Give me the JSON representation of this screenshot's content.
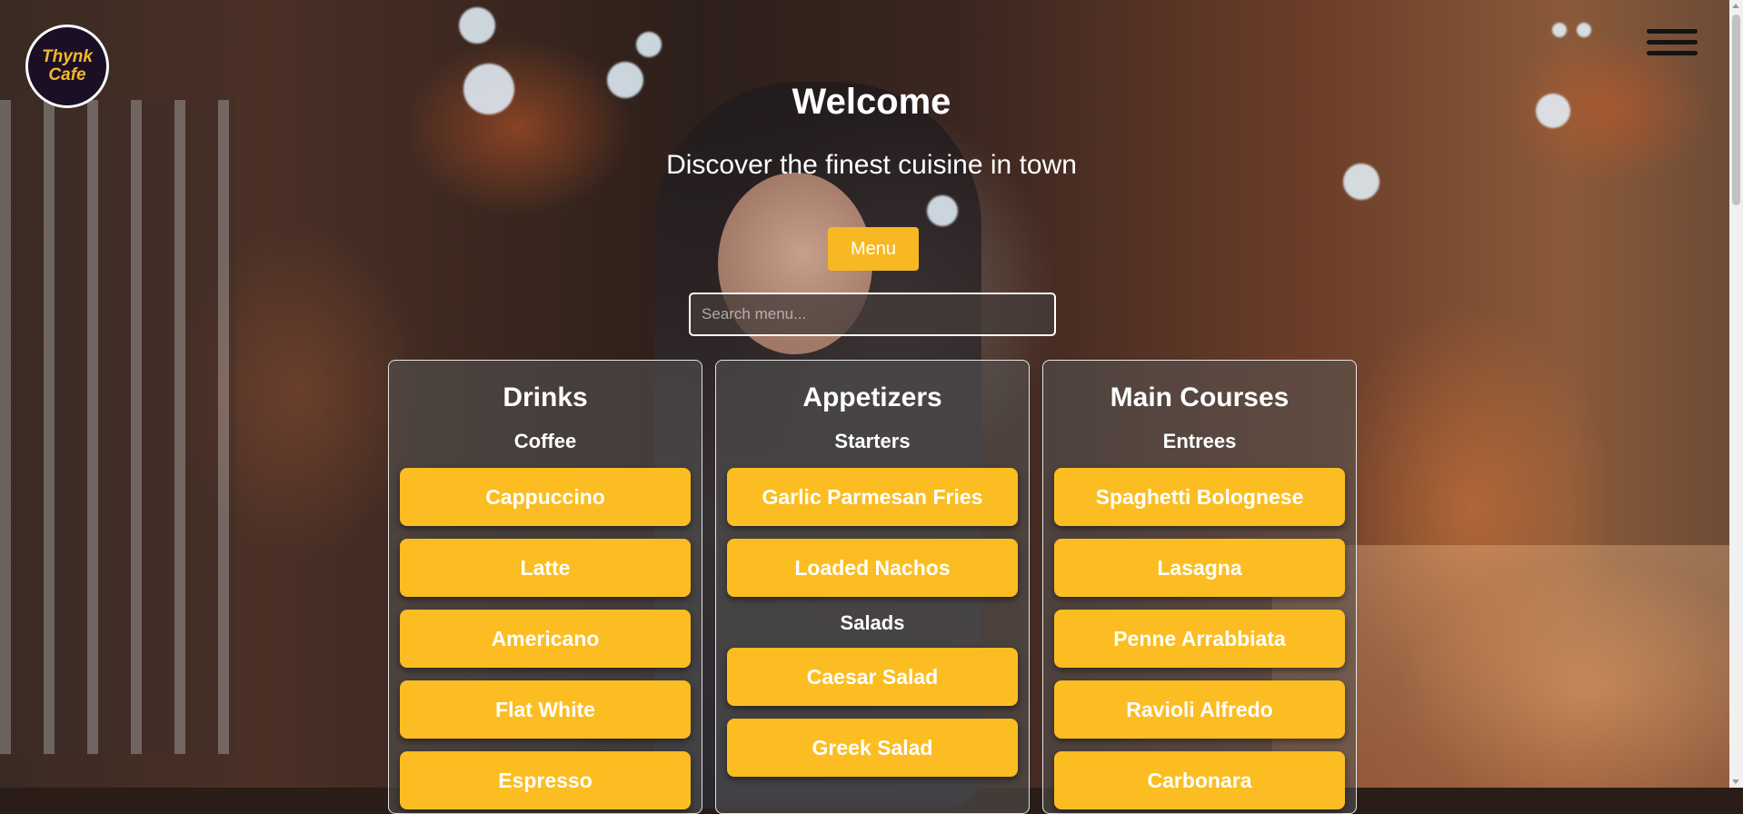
{
  "brand": {
    "logo_text": "Thynk Cafe",
    "accent_color": "#f7b824"
  },
  "nav": {
    "menu_icon": "hamburger-menu-icon"
  },
  "hero": {
    "title": "Welcome",
    "tagline": "Discover the finest cuisine in town",
    "menu_button_label": "Menu",
    "search_placeholder": "Search menu..."
  },
  "categories": [
    {
      "title": "Drinks",
      "groups": [
        {
          "name": "Coffee",
          "items": [
            "Cappuccino",
            "Latte",
            "Americano",
            "Flat White",
            "Espresso"
          ]
        }
      ]
    },
    {
      "title": "Appetizers",
      "groups": [
        {
          "name": "Starters",
          "items": [
            "Garlic Parmesan Fries",
            "Loaded Nachos"
          ]
        },
        {
          "name": "Salads",
          "items": [
            "Caesar Salad",
            "Greek Salad"
          ]
        }
      ]
    },
    {
      "title": "Main Courses",
      "groups": [
        {
          "name": "Entrees",
          "items": [
            "Spaghetti Bolognese",
            "Lasagna",
            "Penne Arrabbiata",
            "Ravioli Alfredo",
            "Carbonara"
          ]
        }
      ]
    }
  ]
}
